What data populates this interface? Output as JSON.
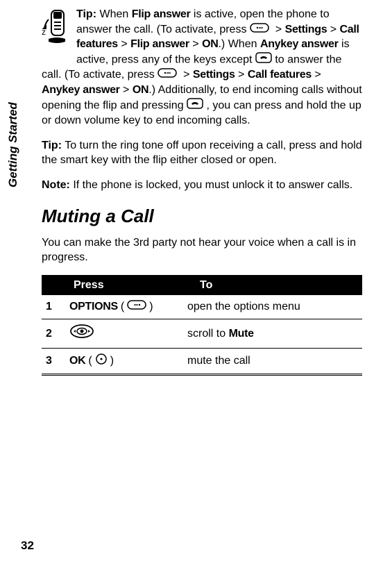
{
  "side_label": "Getting Started",
  "tip_label": "Tip:",
  "note_label": "Note:",
  "para1": {
    "t1": " When ",
    "flip_answer": "Flip answer",
    "t2": " is active, open the phone to answer the call. (To activate, press ",
    "gt": " > ",
    "settings": "Settings",
    "call_features": "Call features",
    "on": "ON",
    "t3": ".) When ",
    "anykey_answer": "Anykey answer",
    "t4": " is active, press any of the keys except ",
    "t5": " to answer the call. (To activate, press ",
    "t6": ".) Additionally, to end incoming calls without opening the flip and pressing ",
    "t7": " , you can press and hold the up or down volume key to end incoming calls."
  },
  "para2": " To turn the ring tone off upon receiving a call, press and hold the smart key with the flip either closed or open.",
  "para3": " If the phone is locked, you must unlock it to answer calls.",
  "heading": "Muting a Call",
  "para4": "You can make the 3rd party not hear your voice when a call is in progress.",
  "table": {
    "hdr_press": "Press",
    "hdr_to": "To",
    "rows": [
      {
        "num": "1",
        "press_label": "OPTIONS",
        "press_paren_open": " ( ",
        "press_paren_close": " )",
        "to": "open the options menu"
      },
      {
        "num": "2",
        "press_label": "",
        "to": "scroll to ",
        "to_bold": "Mute"
      },
      {
        "num": "3",
        "press_label": "OK",
        "press_paren_open": " ( ",
        "press_paren_close": " )",
        "to": "mute the call"
      }
    ]
  },
  "page_number": "32"
}
